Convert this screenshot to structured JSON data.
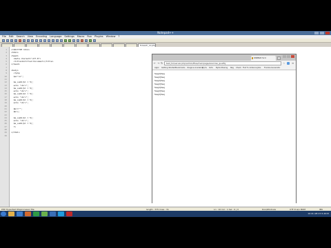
{
  "notepad": {
    "title": "Notepad++",
    "menu": [
      "File",
      "Edit",
      "Search",
      "View",
      "Encoding",
      "Language",
      "Settings",
      "Macro",
      "Run",
      "Plugins",
      "Window",
      "?"
    ],
    "tabs": [
      "",
      "",
      "",
      "",
      "",
      "",
      "",
      "",
      "",
      "",
      "",
      "foreach_xx.php"
    ],
    "code": [
      {
        "n": "1",
        "t": "<!DOCTYPE html>"
      },
      {
        "n": "2",
        "t": "<html>"
      },
      {
        "n": "3",
        "t": "<head>"
      },
      {
        "n": "4",
        "t": "  <meta charset=\"utf-8\">"
      },
      {
        "n": "5",
        "t": "  <title>Untitled Document</title>"
      },
      {
        "n": "6",
        "t": "</head>"
      },
      {
        "n": "7",
        "t": ""
      },
      {
        "n": "8",
        "t": "<body>"
      },
      {
        "n": "9",
        "t": "  <?php"
      },
      {
        "n": "10",
        "t": "  $a=\"ul\";"
      },
      {
        "n": "11",
        "t": ""
      },
      {
        "n": "12",
        "t": "  $a_sumh($l = 5);"
      },
      {
        "n": "13",
        "t": "  echo \"<br>\";"
      },
      {
        "n": "14",
        "t": "  $a_sumh($l = 5);"
      },
      {
        "n": "15",
        "t": "  echo \"<br>\";"
      },
      {
        "n": "16",
        "t": "  $a_sumh($l = 5);"
      },
      {
        "n": "17",
        "t": "  echo \"<br>\";"
      },
      {
        "n": "18",
        "t": "  $a_sumh($l = 5);"
      },
      {
        "n": "19",
        "t": "  echo \"<br>\";"
      },
      {
        "n": "20",
        "t": ""
      },
      {
        "n": "21",
        "t": "  $br=\"\";"
      },
      {
        "n": "22",
        "t": "  $br+;"
      },
      {
        "n": "23",
        "t": ""
      },
      {
        "n": "24",
        "t": "  $a_sumh($l = 5);"
      },
      {
        "n": "25",
        "t": "  echo \"<br>\";"
      },
      {
        "n": "26",
        "t": "  $a_sumh($l = 5);"
      },
      {
        "n": "27",
        "t": "  ?>"
      },
      {
        "n": "28",
        "t": ""
      },
      {
        "n": "29",
        "t": "</html>"
      },
      {
        "n": "30",
        "t": ""
      }
    ],
    "status": {
      "type": "PHP Hypertext Preprocessor file",
      "length": "length : 575    lines : 31",
      "pos": "Ln : 10    Col : 1    Sel : 0 | 0",
      "eol": "Dos\\Windows",
      "enc": "UTF-8 w/o BOM",
      "mode": "INS"
    }
  },
  "taskbar": {
    "icons": [
      {
        "name": "explorer-icon",
        "color": "#e2b04a"
      },
      {
        "name": "media-icon",
        "color": "#3f7fd0"
      },
      {
        "name": "firefox-icon",
        "color": "#d2692e"
      },
      {
        "name": "chrome-icon",
        "color": "#2f9a46"
      },
      {
        "name": "notepadpp-icon",
        "color": "#6ab04c"
      },
      {
        "name": "app-icon",
        "color": "#3a6fb8"
      },
      {
        "name": "skype-icon",
        "color": "#1f9bde"
      },
      {
        "name": "filezilla-icon",
        "color": "#c02a2a"
      }
    ],
    "tray": "10:41 AM  27-5-2015"
  },
  "chrome": {
    "tab_label": "UNMAD Scri",
    "url": "test_ful/server.php/admin/files/mainpage/exercise_qualfiy",
    "bookmarks": [
      "Apps",
      "Getting Started",
      "Bookmarks",
      "Imagine Academy",
      "MyCv",
      "Sofa",
      "Bybin-Boeing",
      "Reg",
      "Check",
      "Flat Tv Antenna",
      "Jobs",
      "Frankie Generator"
    ],
    "output": [
      "5ss|2|5ss|",
      "5ss|2|5ss|",
      "5ss|2|5ss|",
      "5ss|2|5ss|",
      "5ss|2|5ss|",
      "5ss|2|5ss|",
      "5ss|2|5ss|"
    ]
  }
}
